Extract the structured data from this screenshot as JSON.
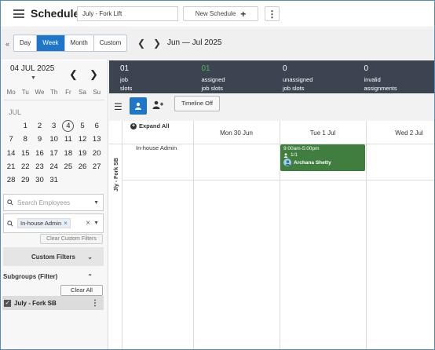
{
  "header": {
    "title": "Schedules",
    "schedule_name": "July - Fork Lift",
    "new_schedule_label": "New Schedule"
  },
  "view": {
    "tabs": [
      "Day",
      "Week",
      "Month",
      "Custom"
    ],
    "active_tab": "Week",
    "date_range": "Jun — Jul 2025"
  },
  "calendar": {
    "selected_label": "04 JUL 2025",
    "weekdays": [
      "Mo",
      "Tu",
      "We",
      "Th",
      "Fr",
      "Sa",
      "Su"
    ],
    "month_label": "JUL",
    "weeks": [
      [
        "",
        "1",
        "2",
        "3",
        "4",
        "5",
        "6"
      ],
      [
        "7",
        "8",
        "9",
        "10",
        "11",
        "12",
        "13"
      ],
      [
        "14",
        "15",
        "16",
        "17",
        "18",
        "19",
        "20"
      ],
      [
        "21",
        "22",
        "23",
        "24",
        "25",
        "26",
        "27"
      ],
      [
        "28",
        "29",
        "30",
        "31",
        "",
        "",
        ""
      ]
    ],
    "today": "4"
  },
  "filters": {
    "search_placeholder": "Search Employees",
    "chip_label": "In-house Admin",
    "clear_custom_label": "Clear Custom Filters",
    "custom_filters_label": "Custom Filters",
    "subgroups_label": "Subgroups (Filter)",
    "clear_all_label": "Clear All",
    "subgroup_item": "July - Fork SB"
  },
  "stats": [
    {
      "value": "01",
      "label1": "job",
      "label2": "slots",
      "color": "#ffffff"
    },
    {
      "value": "01",
      "label1": "assigned",
      "label2": "job slots",
      "color": "#4cbb5a"
    },
    {
      "value": "0",
      "label1": "unassigned",
      "label2": "job slots",
      "color": "#ffffff"
    },
    {
      "value": "0",
      "label1": "invalid",
      "label2": "assignments",
      "color": "#ffffff"
    }
  ],
  "toolbar": {
    "timeline_off_label": "Timeline Off"
  },
  "grid": {
    "expand_all_label": "Expand All",
    "columns": [
      "Mon 30 Jun",
      "Tue 1 Jul",
      "Wed 2 Jul"
    ],
    "group_label": "Jly - Fork SB",
    "role_label": "In-house Admin",
    "shift": {
      "time": "9:00am-5:00pm",
      "slots": "1/1",
      "employee": "Archana Shetty"
    }
  },
  "colors": {
    "accent": "#1d76c8",
    "stats_bg": "#3d4451",
    "shift_bg": "#3f7e3f"
  }
}
